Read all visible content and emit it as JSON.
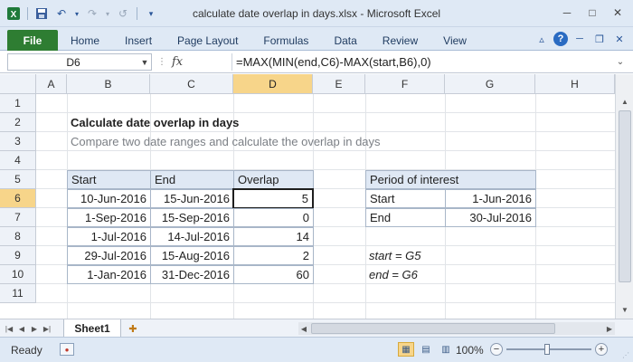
{
  "window": {
    "title": "calculate date overlap in days.xlsx - Microsoft Excel",
    "icons": [
      "excel-logo-icon",
      "save-icon",
      "undo-icon",
      "redo-icon",
      "customize-icon"
    ]
  },
  "ribbon": {
    "file_label": "File",
    "tabs": [
      "Home",
      "Insert",
      "Page Layout",
      "Formulas",
      "Data",
      "Review",
      "View"
    ]
  },
  "formula_bar": {
    "name_box": "D6",
    "fx_label": "fx",
    "formula": "=MAX(MIN(end,C6)-MAX(start,B6),0)"
  },
  "grid": {
    "columns": [
      "A",
      "B",
      "C",
      "D",
      "E",
      "F",
      "G",
      "H"
    ],
    "rows": [
      "1",
      "2",
      "3",
      "4",
      "5",
      "6",
      "7",
      "8",
      "9",
      "10",
      "11"
    ],
    "selected_column": "D",
    "selected_row": "6"
  },
  "content": {
    "title": "Calculate date overlap in days",
    "subtitle": "Compare two date ranges and calculate the overlap in days",
    "table": {
      "headers": [
        "Start",
        "End",
        "Overlap"
      ],
      "rows": [
        [
          "10-Jun-2016",
          "15-Jun-2016",
          "5"
        ],
        [
          "1-Sep-2016",
          "15-Sep-2016",
          "0"
        ],
        [
          "1-Jul-2016",
          "14-Jul-2016",
          "14"
        ],
        [
          "29-Jul-2016",
          "15-Aug-2016",
          "2"
        ],
        [
          "1-Jan-2016",
          "31-Dec-2016",
          "60"
        ]
      ]
    },
    "period": {
      "header": "Period of interest",
      "rows": [
        [
          "Start",
          "1-Jun-2016"
        ],
        [
          "End",
          "30-Jul-2016"
        ]
      ]
    },
    "notes": [
      "start = G5",
      "end = G6"
    ]
  },
  "sheets": {
    "active": "Sheet1"
  },
  "status": {
    "ready": "Ready",
    "zoom": "100%"
  }
}
